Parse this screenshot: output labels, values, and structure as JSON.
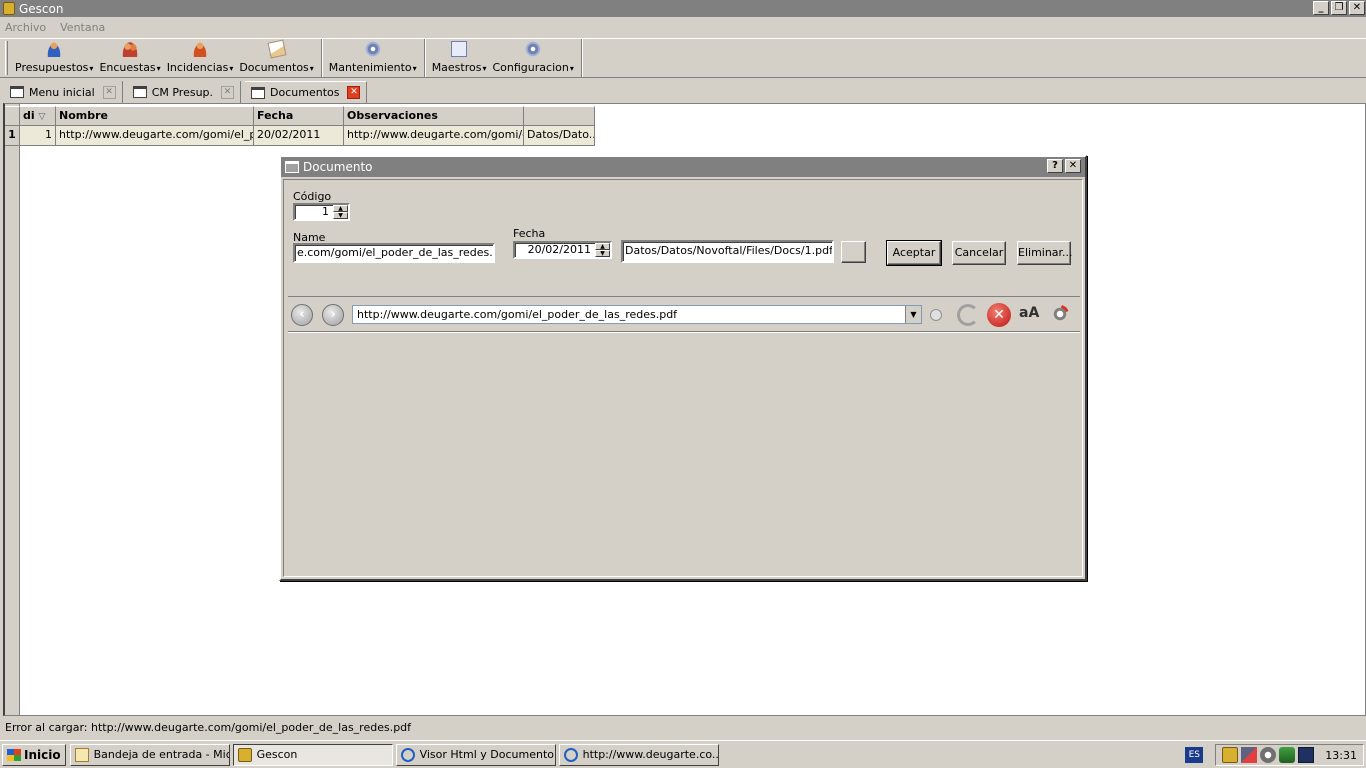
{
  "window": {
    "title": "Gescon"
  },
  "menu": [
    "Archivo",
    "Ventana"
  ],
  "toolbar": {
    "group1": [
      {
        "label": "Presupuestos",
        "icon": "person-icon"
      },
      {
        "label": "Encuestas",
        "icon": "people-icon"
      },
      {
        "label": "Incidencias",
        "icon": "incident-icon"
      },
      {
        "label": "Documentos",
        "icon": "documents-icon"
      }
    ],
    "group2": [
      {
        "label": "Mantenimiento",
        "icon": "gear-icon"
      }
    ],
    "group3": [
      {
        "label": "Maestros",
        "icon": "masters-icon"
      },
      {
        "label": "Configuracion",
        "icon": "gear-icon"
      }
    ]
  },
  "tabs": [
    {
      "label": "Menu inicial"
    },
    {
      "label": "CM Presup."
    },
    {
      "label": "Documentos",
      "active": true
    }
  ],
  "grid": {
    "headers": [
      "di",
      "Nombre",
      "Fecha",
      "Observaciones",
      ""
    ],
    "rows": [
      {
        "num": "1",
        "id": "1",
        "nombre": "http://www.deugarte.com/gomi/el_p...",
        "fecha": "20/02/2011",
        "obs": "http://www.deugarte.com/gomi/e...",
        "extra": "Datos/Dato..."
      }
    ]
  },
  "dialog": {
    "title": "Documento",
    "codigo_label": "Código",
    "codigo_value": "1",
    "name_label": "Name",
    "name_value": "e.com/gomi/el_poder_de_las_redes.pdf",
    "fecha_label": "Fecha",
    "fecha_value": "20/02/2011",
    "path_value": "Datos/Datos/Novoftal/Files/Docs/1.pdf",
    "buttons": {
      "aceptar": "Aceptar",
      "cancelar": "Cancelar",
      "eliminar": "Eliminar..."
    },
    "url": "http://www.deugarte.com/gomi/el_poder_de_las_redes.pdf",
    "font_icon_text": "aA"
  },
  "status": "Error al cargar: http://www.deugarte.com/gomi/el_poder_de_las_redes.pdf",
  "taskbar": {
    "start": "Inicio",
    "buttons": [
      {
        "label": "Bandeja de entrada - Mic...",
        "icon": "mail-icon"
      },
      {
        "label": "Gescon",
        "icon": "gescon-icon",
        "pressed": true
      },
      {
        "label": "Visor Html y Documento ...",
        "icon": "ie-icon"
      },
      {
        "label": "http://www.deugarte.co...",
        "icon": "ie-icon"
      }
    ],
    "lang": "ES",
    "clock": "13:31"
  }
}
